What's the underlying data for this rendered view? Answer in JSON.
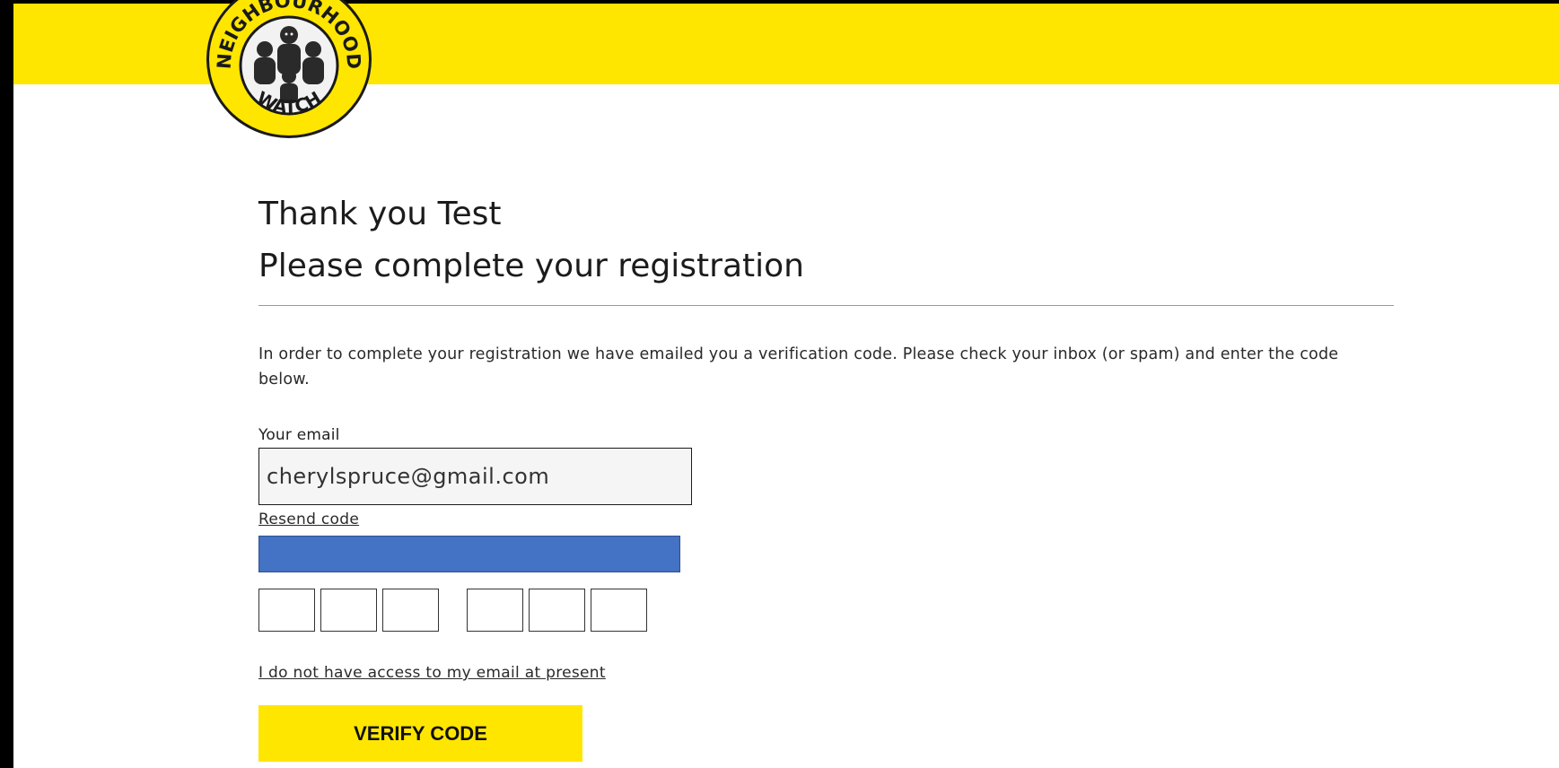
{
  "brand": {
    "logo_text_top": "NEIGHBOURHOOD",
    "logo_text_bottom": "WATCH",
    "accent_color": "#ffe600"
  },
  "main": {
    "heading_line1": "Thank you Test",
    "heading_line2": "Please complete your registration",
    "instructions": "In order to complete your registration we have emailed you a verification code. Please check your inbox (or spam) and enter the code below.",
    "email_label": "Your email",
    "email_value": "cherylspruce@gmail.com",
    "resend_link": "Resend code",
    "no_access_link": "I do not have access to my email at present",
    "verify_button": "VERIFY CODE"
  },
  "code_inputs": [
    "",
    "",
    "",
    "",
    "",
    ""
  ]
}
